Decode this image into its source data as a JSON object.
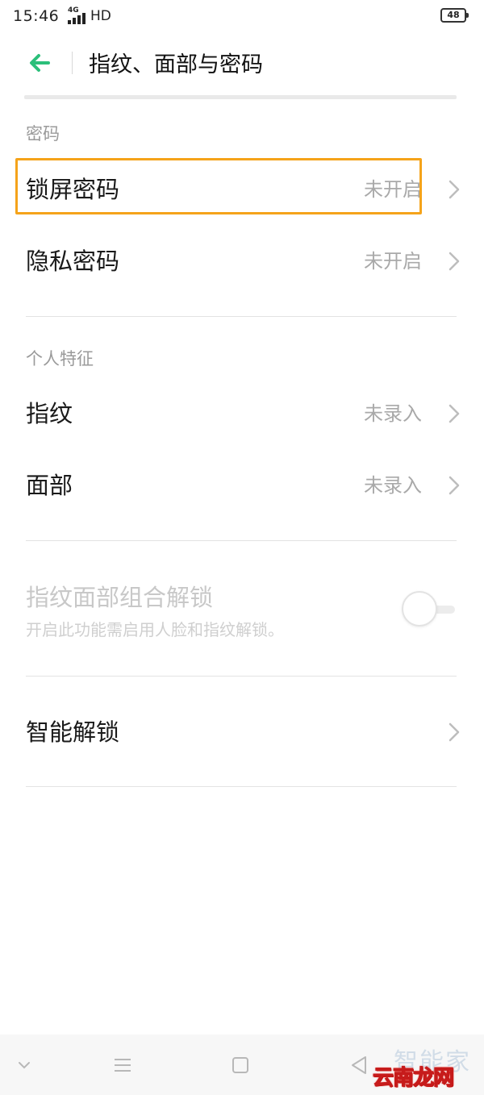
{
  "status_bar": {
    "time": "15:46",
    "network": "4G",
    "hd": "HD",
    "battery": "48"
  },
  "header": {
    "title": "指纹、面部与密码",
    "back_icon": "arrow-left-icon",
    "accent": "#2bbf7a"
  },
  "sections": {
    "password": {
      "title": "密码",
      "items": [
        {
          "label": "锁屏密码",
          "value": "未开启"
        },
        {
          "label": "隐私密码",
          "value": "未开启"
        }
      ]
    },
    "personal": {
      "title": "个人特征",
      "items": [
        {
          "label": "指纹",
          "value": "未录入"
        },
        {
          "label": "面部",
          "value": "未录入"
        }
      ]
    },
    "combo_unlock": {
      "label": "指纹面部组合解锁",
      "description": "开启此功能需启用人脸和指纹解锁。",
      "toggle_on": false
    },
    "smart_unlock": {
      "label": "智能解锁"
    }
  },
  "highlight_color": "#f5a31a",
  "nav_bar": {
    "icons": [
      "chevron-down-icon",
      "menu-icon",
      "home-square-icon",
      "back-triangle-icon"
    ]
  },
  "watermark": {
    "top": "智能家",
    "bottom": "云南龙网"
  }
}
